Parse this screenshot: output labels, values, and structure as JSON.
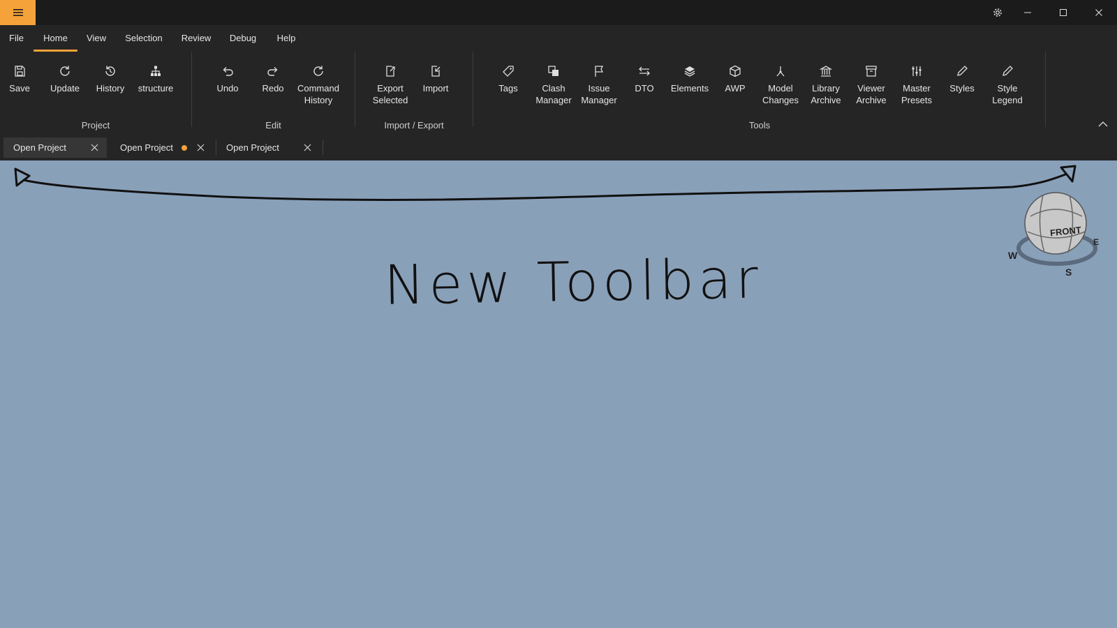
{
  "menu": {
    "items": [
      {
        "label": "File",
        "active": false
      },
      {
        "label": "Home",
        "active": true
      },
      {
        "label": "View",
        "active": false
      },
      {
        "label": "Selection",
        "active": false
      },
      {
        "label": "Review",
        "active": false
      },
      {
        "label": "Debug",
        "active": false
      },
      {
        "label": "Help",
        "active": false
      }
    ]
  },
  "ribbon": {
    "groups": {
      "project": "Project",
      "edit": "Edit",
      "import_export": "Import / Export",
      "tools": "Tools"
    },
    "buttons": {
      "save": "Save",
      "update": "Update",
      "history": "History",
      "structure": "structure",
      "undo": "Undo",
      "redo": "Redo",
      "command_history": "Command\nHistory",
      "export_selected": "Export\nSelected",
      "import": "Import",
      "tags": "Tags",
      "clash_manager": "Clash\nManager",
      "issue_manager": "Issue\nManager",
      "dto": "DTO",
      "elements": "Elements",
      "awp": "AWP",
      "model_changes": "Model\nChanges",
      "library_archive": "Library\nArchive",
      "viewer_archive": "Viewer\nArchive",
      "master_presets": "Master\nPresets",
      "styles": "Styles",
      "style_legend": "Style\nLegend"
    }
  },
  "tabs": [
    {
      "label": "Open Project",
      "active": true,
      "modified": false
    },
    {
      "label": "Open Project",
      "active": false,
      "modified": true
    },
    {
      "label": "Open Project",
      "active": false,
      "modified": false
    }
  ],
  "viewport": {
    "annotation": "New Toolbar",
    "viewcube": {
      "face": "FRONT",
      "compass": [
        "W",
        "S",
        "E"
      ]
    }
  },
  "colors": {
    "accent": "#f5a23a",
    "titlebar": "#1b1b1b",
    "ribbon": "#252525",
    "viewport": "#89a0b9"
  },
  "icons": [
    "menu-icon",
    "gear-icon",
    "minimize-icon",
    "maximize-icon",
    "close-icon",
    "save-icon",
    "refresh-icon",
    "history-icon",
    "hierarchy-icon",
    "undo-icon",
    "redo-icon",
    "export-icon",
    "import-icon",
    "tag-icon",
    "clash-icon",
    "flag-icon",
    "swap-icon",
    "layers-icon",
    "cube-icon",
    "branch-icon",
    "bank-icon",
    "archive-icon",
    "sliders-icon",
    "pencil-icon",
    "chevron-up-icon"
  ]
}
